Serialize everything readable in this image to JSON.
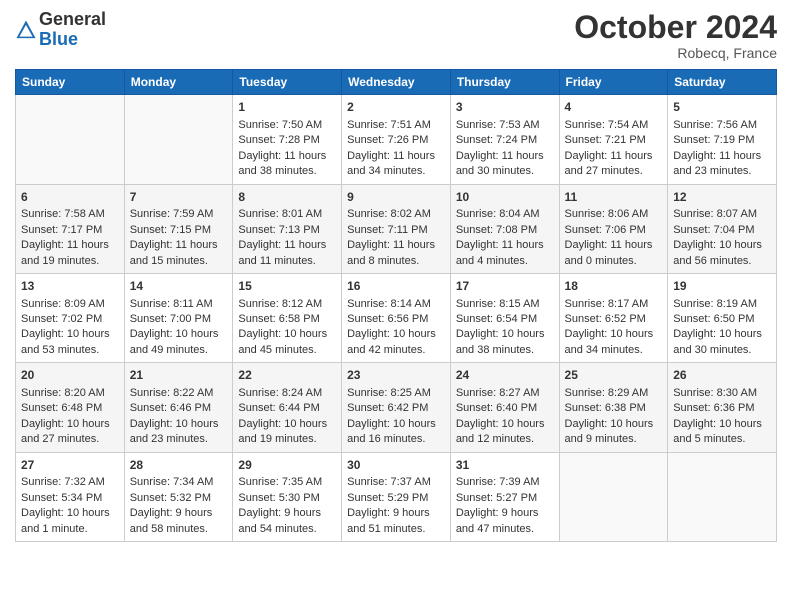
{
  "header": {
    "logo_general": "General",
    "logo_blue": "Blue",
    "month_title": "October 2024",
    "location": "Robecq, France"
  },
  "days_of_week": [
    "Sunday",
    "Monday",
    "Tuesday",
    "Wednesday",
    "Thursday",
    "Friday",
    "Saturday"
  ],
  "weeks": [
    [
      {
        "day": "",
        "content": ""
      },
      {
        "day": "",
        "content": ""
      },
      {
        "day": "1",
        "content": "Sunrise: 7:50 AM\nSunset: 7:28 PM\nDaylight: 11 hours and 38 minutes."
      },
      {
        "day": "2",
        "content": "Sunrise: 7:51 AM\nSunset: 7:26 PM\nDaylight: 11 hours and 34 minutes."
      },
      {
        "day": "3",
        "content": "Sunrise: 7:53 AM\nSunset: 7:24 PM\nDaylight: 11 hours and 30 minutes."
      },
      {
        "day": "4",
        "content": "Sunrise: 7:54 AM\nSunset: 7:21 PM\nDaylight: 11 hours and 27 minutes."
      },
      {
        "day": "5",
        "content": "Sunrise: 7:56 AM\nSunset: 7:19 PM\nDaylight: 11 hours and 23 minutes."
      }
    ],
    [
      {
        "day": "6",
        "content": "Sunrise: 7:58 AM\nSunset: 7:17 PM\nDaylight: 11 hours and 19 minutes."
      },
      {
        "day": "7",
        "content": "Sunrise: 7:59 AM\nSunset: 7:15 PM\nDaylight: 11 hours and 15 minutes."
      },
      {
        "day": "8",
        "content": "Sunrise: 8:01 AM\nSunset: 7:13 PM\nDaylight: 11 hours and 11 minutes."
      },
      {
        "day": "9",
        "content": "Sunrise: 8:02 AM\nSunset: 7:11 PM\nDaylight: 11 hours and 8 minutes."
      },
      {
        "day": "10",
        "content": "Sunrise: 8:04 AM\nSunset: 7:08 PM\nDaylight: 11 hours and 4 minutes."
      },
      {
        "day": "11",
        "content": "Sunrise: 8:06 AM\nSunset: 7:06 PM\nDaylight: 11 hours and 0 minutes."
      },
      {
        "day": "12",
        "content": "Sunrise: 8:07 AM\nSunset: 7:04 PM\nDaylight: 10 hours and 56 minutes."
      }
    ],
    [
      {
        "day": "13",
        "content": "Sunrise: 8:09 AM\nSunset: 7:02 PM\nDaylight: 10 hours and 53 minutes."
      },
      {
        "day": "14",
        "content": "Sunrise: 8:11 AM\nSunset: 7:00 PM\nDaylight: 10 hours and 49 minutes."
      },
      {
        "day": "15",
        "content": "Sunrise: 8:12 AM\nSunset: 6:58 PM\nDaylight: 10 hours and 45 minutes."
      },
      {
        "day": "16",
        "content": "Sunrise: 8:14 AM\nSunset: 6:56 PM\nDaylight: 10 hours and 42 minutes."
      },
      {
        "day": "17",
        "content": "Sunrise: 8:15 AM\nSunset: 6:54 PM\nDaylight: 10 hours and 38 minutes."
      },
      {
        "day": "18",
        "content": "Sunrise: 8:17 AM\nSunset: 6:52 PM\nDaylight: 10 hours and 34 minutes."
      },
      {
        "day": "19",
        "content": "Sunrise: 8:19 AM\nSunset: 6:50 PM\nDaylight: 10 hours and 30 minutes."
      }
    ],
    [
      {
        "day": "20",
        "content": "Sunrise: 8:20 AM\nSunset: 6:48 PM\nDaylight: 10 hours and 27 minutes."
      },
      {
        "day": "21",
        "content": "Sunrise: 8:22 AM\nSunset: 6:46 PM\nDaylight: 10 hours and 23 minutes."
      },
      {
        "day": "22",
        "content": "Sunrise: 8:24 AM\nSunset: 6:44 PM\nDaylight: 10 hours and 19 minutes."
      },
      {
        "day": "23",
        "content": "Sunrise: 8:25 AM\nSunset: 6:42 PM\nDaylight: 10 hours and 16 minutes."
      },
      {
        "day": "24",
        "content": "Sunrise: 8:27 AM\nSunset: 6:40 PM\nDaylight: 10 hours and 12 minutes."
      },
      {
        "day": "25",
        "content": "Sunrise: 8:29 AM\nSunset: 6:38 PM\nDaylight: 10 hours and 9 minutes."
      },
      {
        "day": "26",
        "content": "Sunrise: 8:30 AM\nSunset: 6:36 PM\nDaylight: 10 hours and 5 minutes."
      }
    ],
    [
      {
        "day": "27",
        "content": "Sunrise: 7:32 AM\nSunset: 5:34 PM\nDaylight: 10 hours and 1 minute."
      },
      {
        "day": "28",
        "content": "Sunrise: 7:34 AM\nSunset: 5:32 PM\nDaylight: 9 hours and 58 minutes."
      },
      {
        "day": "29",
        "content": "Sunrise: 7:35 AM\nSunset: 5:30 PM\nDaylight: 9 hours and 54 minutes."
      },
      {
        "day": "30",
        "content": "Sunrise: 7:37 AM\nSunset: 5:29 PM\nDaylight: 9 hours and 51 minutes."
      },
      {
        "day": "31",
        "content": "Sunrise: 7:39 AM\nSunset: 5:27 PM\nDaylight: 9 hours and 47 minutes."
      },
      {
        "day": "",
        "content": ""
      },
      {
        "day": "",
        "content": ""
      }
    ]
  ]
}
